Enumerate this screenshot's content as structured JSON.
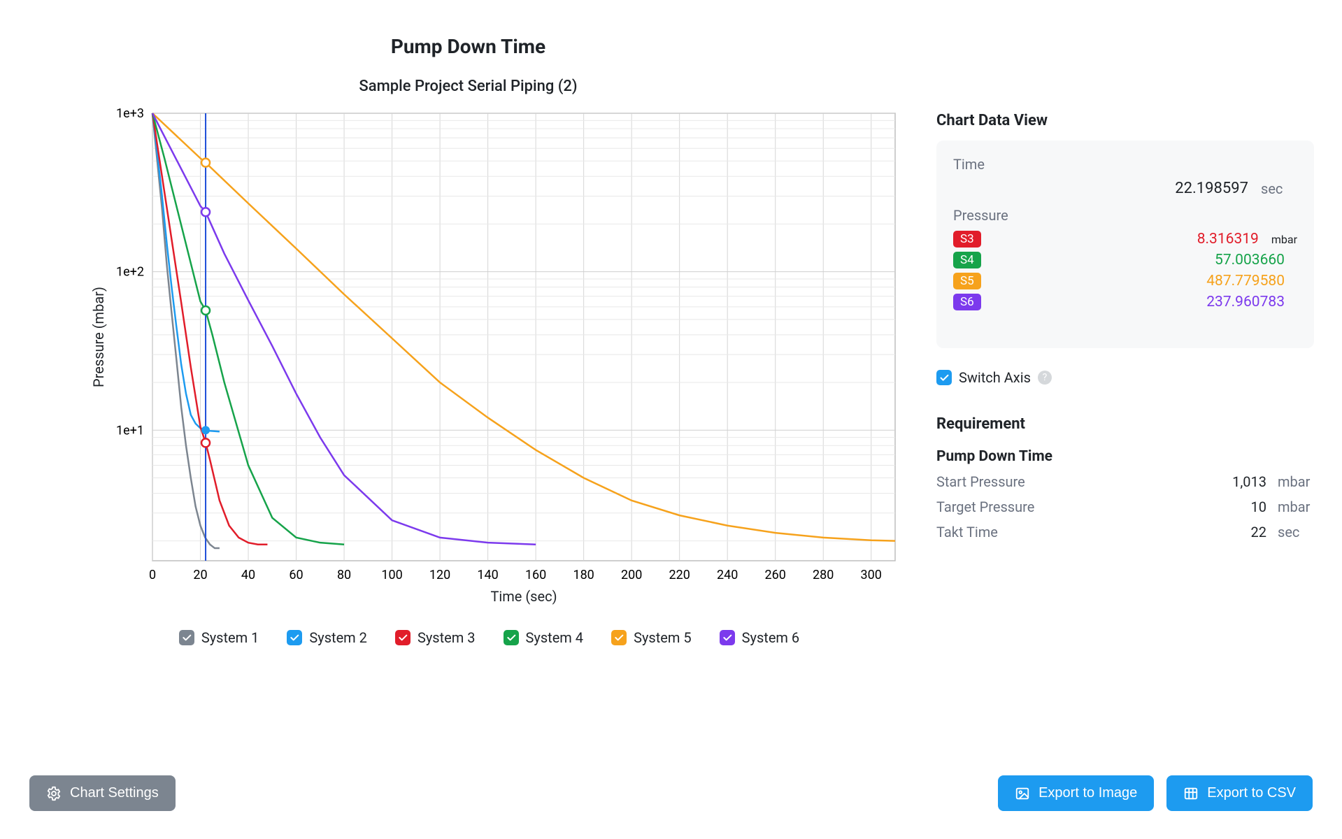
{
  "title": "Pump Down Time",
  "subtitle": "Sample Project Serial Piping (2)",
  "axis": {
    "xlabel": "Time (sec)",
    "ylabel": "Pressure (mbar)"
  },
  "x_ticks": [
    0,
    20,
    40,
    60,
    80,
    100,
    120,
    140,
    160,
    180,
    200,
    220,
    240,
    260,
    280,
    300
  ],
  "y_ticks": [
    "1e+1",
    "1e+2",
    "1e+3"
  ],
  "colors": {
    "s1": "#7c8590",
    "s2": "#1d9bf0",
    "s3": "#e11d2a",
    "s4": "#16a34a",
    "s5": "#f6a21c",
    "s6": "#7c3aed"
  },
  "legend": [
    {
      "id": "s1",
      "label": "System 1"
    },
    {
      "id": "s2",
      "label": "System 2"
    },
    {
      "id": "s3",
      "label": "System 3"
    },
    {
      "id": "s4",
      "label": "System 4"
    },
    {
      "id": "s5",
      "label": "System 5"
    },
    {
      "id": "s6",
      "label": "System 6"
    }
  ],
  "cursor_x": 22.198597,
  "markers": [
    {
      "series": "s2",
      "y": 10.0,
      "filled": true
    },
    {
      "series": "s3",
      "y": 8.316319,
      "filled": false
    },
    {
      "series": "s4",
      "y": 57.00366,
      "filled": false
    },
    {
      "series": "s5",
      "y": 487.77958,
      "filled": false
    },
    {
      "series": "s6",
      "y": 237.960783,
      "filled": false
    }
  ],
  "side": {
    "heading": "Chart Data View",
    "time_label": "Time",
    "time_value": "22.198597",
    "time_unit": "sec",
    "pressure_label": "Pressure",
    "pressure_unit": "mbar",
    "rows": [
      {
        "badge": "S3",
        "color": "s3",
        "value": "8.316319"
      },
      {
        "badge": "S4",
        "color": "s4",
        "value": "57.003660"
      },
      {
        "badge": "S5",
        "color": "s5",
        "value": "487.779580"
      },
      {
        "badge": "S6",
        "color": "s6",
        "value": "237.960783"
      }
    ],
    "switch_label": "Switch Axis"
  },
  "requirement": {
    "heading": "Requirement",
    "subheading": "Pump Down Time",
    "rows": [
      {
        "k": "Start Pressure",
        "v": "1,013",
        "u": "mbar"
      },
      {
        "k": "Target Pressure",
        "v": "10",
        "u": "mbar"
      },
      {
        "k": "Takt Time",
        "v": "22",
        "u": "sec"
      }
    ]
  },
  "buttons": {
    "settings": "Chart Settings",
    "export_image": "Export to Image",
    "export_csv": "Export to CSV"
  },
  "chart_data": {
    "type": "line",
    "title": "Pump Down Time",
    "xlabel": "Time (sec)",
    "ylabel": "Pressure (mbar)",
    "x_range": [
      0,
      310
    ],
    "y_range": [
      1.5,
      1000
    ],
    "y_scale": "log",
    "cursor": 22.198597,
    "series": [
      {
        "name": "System 1",
        "color": "#7c8590",
        "x": [
          0,
          2,
          4,
          6,
          8,
          10,
          12,
          14,
          16,
          18,
          20,
          22,
          24,
          26,
          28
        ],
        "y": [
          1000,
          500,
          250,
          110,
          55,
          28,
          14,
          8,
          5,
          3.3,
          2.5,
          2.1,
          1.9,
          1.8,
          1.8
        ]
      },
      {
        "name": "System 2",
        "color": "#1d9bf0",
        "x": [
          0,
          2,
          4,
          6,
          8,
          10,
          12,
          14,
          16,
          18,
          20,
          22.2,
          24,
          26,
          28
        ],
        "y": [
          1000,
          560,
          300,
          150,
          80,
          45,
          26,
          17,
          12.5,
          11,
          10.3,
          10,
          9.9,
          9.85,
          9.8
        ]
      },
      {
        "name": "System 3",
        "color": "#e11d2a",
        "x": [
          0,
          4,
          8,
          12,
          16,
          20,
          22.2,
          24,
          28,
          32,
          36,
          40,
          44,
          48
        ],
        "y": [
          1000,
          400,
          160,
          64,
          25,
          10.5,
          8.32,
          6.5,
          3.6,
          2.5,
          2.1,
          1.95,
          1.9,
          1.9
        ]
      },
      {
        "name": "System 4",
        "color": "#16a34a",
        "x": [
          0,
          5,
          10,
          15,
          20,
          22.2,
          25,
          30,
          40,
          50,
          60,
          70,
          80
        ],
        "y": [
          1000,
          520,
          260,
          130,
          65,
          57.0,
          40,
          20,
          6,
          2.8,
          2.1,
          1.95,
          1.9
        ]
      },
      {
        "name": "System 5",
        "color": "#f6a21c",
        "x": [
          0,
          20,
          22.2,
          40,
          60,
          80,
          100,
          120,
          140,
          160,
          180,
          200,
          220,
          240,
          260,
          280,
          300,
          310
        ],
        "y": [
          1000,
          520,
          487.8,
          270,
          140,
          72,
          38,
          20,
          12,
          7.5,
          5,
          3.6,
          2.9,
          2.5,
          2.25,
          2.1,
          2.02,
          2.0
        ]
      },
      {
        "name": "System 6",
        "color": "#7c3aed",
        "x": [
          0,
          10,
          20,
          22.2,
          30,
          40,
          50,
          60,
          70,
          80,
          100,
          120,
          140,
          160
        ],
        "y": [
          1000,
          510,
          260,
          237.96,
          130,
          66,
          34,
          17,
          9,
          5.2,
          2.7,
          2.1,
          1.95,
          1.9
        ]
      }
    ]
  }
}
